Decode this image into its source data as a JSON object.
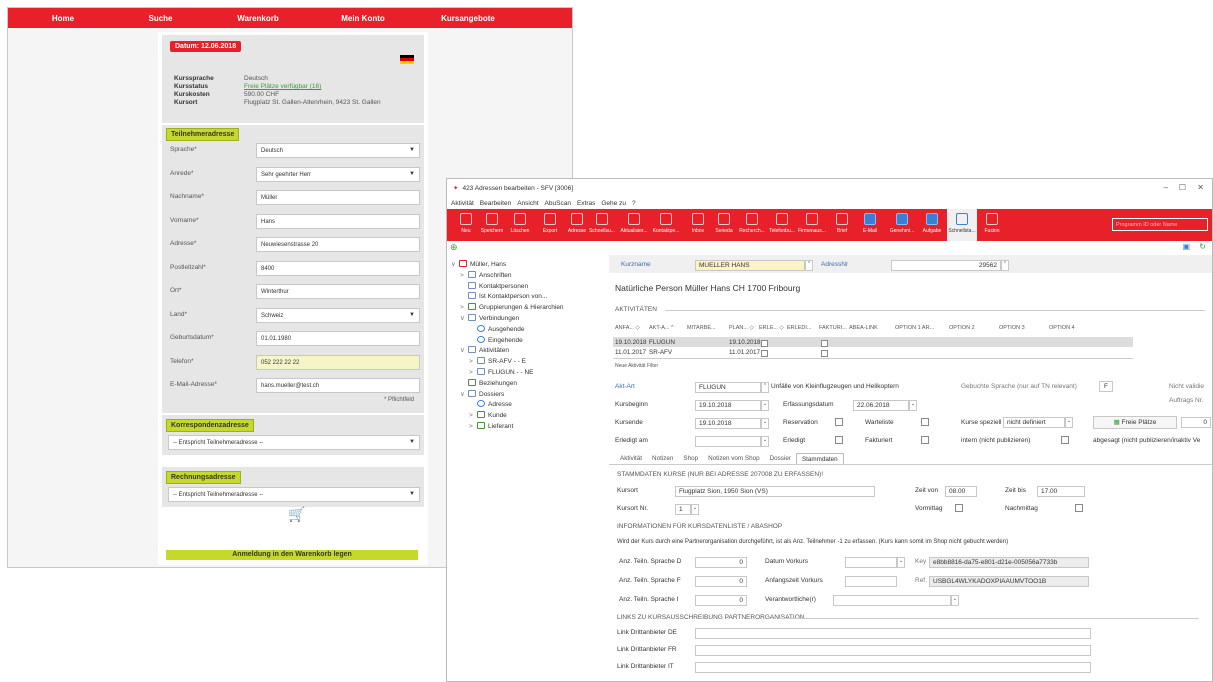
{
  "shop": {
    "nav": [
      "Home",
      "Suche",
      "Warenkorb",
      "Mein Konto",
      "Kursangebote"
    ],
    "date_badge": "Datum: 12.06.2018",
    "course_info": [
      {
        "label": "Kurssprache",
        "value": "Deutsch"
      },
      {
        "label": "Kursstatus",
        "value": "Freie Plätze verfügbar (16)"
      },
      {
        "label": "Kurskosten",
        "value": "590.00 CHF"
      },
      {
        "label": "Kursort",
        "value": "Flugplatz St. Gallen-Altenrhein, 9423 St. Gallen"
      }
    ],
    "participant_section": "Teilnehmeradresse",
    "fields": [
      {
        "label": "Sprache*",
        "value": "Deutsch",
        "select": true
      },
      {
        "label": "Anrede*",
        "value": "Sehr geehrter Herr",
        "select": true
      },
      {
        "label": "Nachname*",
        "value": "Müller"
      },
      {
        "label": "Vorname*",
        "value": "Hans"
      },
      {
        "label": "Adresse*",
        "value": "Neuwiesenstrasse 20"
      },
      {
        "label": "Postleitzahl*",
        "value": "8400"
      },
      {
        "label": "Ort*",
        "value": "Winterthur"
      },
      {
        "label": "Land*",
        "value": "Schweiz",
        "select": true
      },
      {
        "label": "Geburtsdatum*",
        "value": "01.01.1980"
      },
      {
        "label": "Telefon*",
        "value": "052 222 22 22",
        "highlight": true
      },
      {
        "label": "E-Mail-Adresse*",
        "value": "hans.mueller@test.ch"
      }
    ],
    "required_note": "* Pflichtfeld",
    "correspondence_section": "Korrespondenzadresse",
    "correspondence_value": "-- Entspricht Teilnehmeradresse --",
    "billing_section": "Rechnungsadresse",
    "billing_value": "-- Entspricht Teilnehmeradresse --",
    "register_button": "Anmeldung in den Warenkorb legen"
  },
  "app": {
    "title": "423 Adressen bearbeiten - SFV [3006]",
    "menu": [
      "Aktivität",
      "Bearbeiten",
      "Ansicht",
      "AbuScan",
      "Extras",
      "Gehe zu",
      "?"
    ],
    "ribbon": [
      "Neu",
      "Speichern",
      "Löschen",
      "Export",
      "Adresse",
      "Schnellsu...",
      "Aktualisier...",
      "Kontaktpe...",
      "Inbox",
      "Serieda",
      "Recherch...",
      "Telefonbu...",
      "Firmenaus...",
      "Brief",
      "E-Mail",
      "Genehmi...",
      "Aufgabe",
      "Schnellsta...",
      "Fusion"
    ],
    "search_placeholder": "Programm ID oder Name",
    "tree": [
      {
        "label": "Müller, Hans",
        "indent": 0,
        "exp": "∨",
        "icon": "person"
      },
      {
        "label": "Anschriften",
        "indent": 1,
        "exp": ">",
        "icon": "blue"
      },
      {
        "label": "Kontaktpersonen",
        "indent": 1,
        "exp": "",
        "icon": "blue"
      },
      {
        "label": "Ist Kontaktperson von...",
        "indent": 1,
        "exp": "",
        "icon": "blue"
      },
      {
        "label": "Gruppierungen & Hierarchien",
        "indent": 1,
        "exp": ">",
        "icon": "green"
      },
      {
        "label": "Verbindungen",
        "indent": 1,
        "exp": "∨",
        "icon": "blue"
      },
      {
        "label": "Ausgehende",
        "indent": 2,
        "exp": "",
        "icon": "blue"
      },
      {
        "label": "Eingehende",
        "indent": 2,
        "exp": "",
        "icon": "blue"
      },
      {
        "label": "Aktivitäten",
        "indent": 1,
        "exp": "∨",
        "icon": "blue"
      },
      {
        "label": "SR-AFV - - E",
        "indent": 2,
        "exp": ">",
        "icon": "blue"
      },
      {
        "label": "FLUGUN - - NE",
        "indent": 2,
        "exp": ">",
        "icon": "blue"
      },
      {
        "label": "Beziehungen",
        "indent": 1,
        "exp": "",
        "icon": "green"
      },
      {
        "label": "Dossiers",
        "indent": 1,
        "exp": "∨",
        "icon": "blue"
      },
      {
        "label": "Adresse",
        "indent": 2,
        "exp": "",
        "icon": "blue"
      },
      {
        "label": "Kunde",
        "indent": 2,
        "exp": ">",
        "icon": "green"
      },
      {
        "label": "Lieferant",
        "indent": 2,
        "exp": ">",
        "icon": "green"
      }
    ],
    "kurzname_label": "Kurzname",
    "kurzname": "MUELLER HANS",
    "adressnr_label": "AdressNr",
    "adressnr": "29562",
    "person_title": "Natürliche Person Müller Hans CH 1700 Fribourg",
    "activities_label": "AKTIVITÄTEN",
    "grid_headers": [
      "ANFA... ◇",
      "AKT-A... ^",
      "MITARBE...",
      "PLAN... ◇",
      "ERLE... ◇",
      "ERLEDI...",
      "FAKTURI...",
      "ABEA-LINK",
      "OPTION 1 AR...",
      "OPTION 2",
      "OPTION 3",
      "OPTION 4"
    ],
    "grid_rows": [
      {
        "date": "19.10.2018",
        "code": "FLUGUN",
        "plan": "19.10.2018",
        "sel": true
      },
      {
        "date": "11.01.2017",
        "code": "SR-AFV",
        "plan": "11.01.2017",
        "sel": false
      }
    ],
    "grid_toolbar": [
      "Neue Aktivität",
      "Filter"
    ],
    "akt_art_label": "Akt-Art",
    "akt_art": "FLUGUN",
    "akt_art_desc": "Unfälle von Kleinflugzeugen und Helikoptern",
    "lang_label": "Gebuchte Sprache (nur auf TN relevant)",
    "lang": "F",
    "not_valid": "Nicht validie",
    "auftrag_label": "Auftrags Nr.",
    "kursbeginn_label": "Kursbeginn",
    "kursbeginn": "19.10.2018",
    "erfassung_label": "Erfassungsdatum",
    "erfassung": "22.06.2018",
    "kursende_label": "Kursende",
    "kursende": "19.10.2018",
    "reservation_label": "Reservation",
    "warteliste_label": "Warteliste",
    "kurse_spez_label": "Kurse speziell",
    "kurse_spez": "nicht definiert",
    "freie_button": "Freie Plätze",
    "freie_count": "0",
    "erledigt_am_label": "Erledigt am",
    "erledigt_label": "Erledigt",
    "fakturiert_label": "Fakturiert",
    "intern_label": "intern (nicht publizieren)",
    "abgesagt_label": "abgesagt (nicht publizieren/inaktiv Ve",
    "tabs": [
      "Aktivität",
      "Notizen",
      "Shop",
      "Notizen vom Shop",
      "Dossier",
      "Stammdaten"
    ],
    "stamm_header": "STAMMDATEN KURSE (NUR BEI ADRESSE 207008 ZU ERFASSEN)!",
    "kursort_label": "Kursort",
    "kursort": "Flugplatz Sion, 1950 Sion (VS)",
    "zeit_von_label": "Zeit von",
    "zeit_von": "08.00",
    "zeit_bis_label": "Zeit bis",
    "zeit_bis": "17.00",
    "kurs_nr_label": "Kursort Nr.",
    "kurs_nr": "1",
    "vormittag_label": "Vormittag",
    "nachmittag_label": "Nachmittag",
    "info_header": "INFORMATIONEN FÜR KURSDATENLISTE / ABASHOP",
    "info_text": "Wird der Kurs durch eine Partnerorganisation durchgeführt, ist als Anz. Teilnehmer -1 zu erfassen. (Kurs kann somit im Shop nicht gebucht werden)",
    "anz_d_label": "Anz. Teiln. Sprache D",
    "anz_d": "0",
    "anz_f_label": "Anz. Teiln. Sprache F",
    "anz_f": "0",
    "anz_i_label": "Anz. Teiln. Sprache I",
    "anz_i": "0",
    "vorkurs_label": "Datum Vorkurs",
    "anfang_label": "Anfangszeit Vorkurs",
    "verantw_label": "Verantwortliche(r)",
    "key_label": "Key",
    "key": "e8bb8816-da75-e801-d21e-005056a7733b",
    "ref_label": "Ref.",
    "ref": "USBGL4WLYKADOXPIAAUMVTOO1B",
    "links_header": "LINKS ZU KURSAUSSCHREIBUNG PARTNERORGANISATION",
    "link_de": "Link Drittanbieter DE",
    "link_fr": "Link Drittanbieter FR",
    "link_it": "Link Drittanbieter  IT"
  }
}
